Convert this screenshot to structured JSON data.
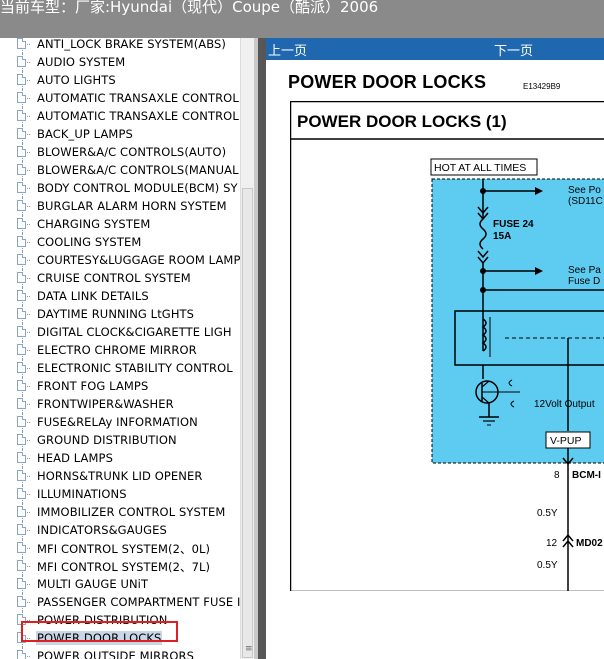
{
  "window": {
    "title": "当前车型：厂家:Hyundai（现代）Coupe（酷派）2006"
  },
  "tree": {
    "items": [
      "ANTI_LOCK BRAKE SYSTEM(ABS)",
      "AUDIO SYSTEM",
      "AUTO LIGHTS",
      "AUTOMATIC TRANSAXLE CONTROL",
      "AUTOMATIC TRANSAXLE CONTROL",
      "BACK_UP LAMPS",
      "BLOWER&A/C CONTROLS(AUTO)",
      "BLOWER&A/C CONTROLS(MANUAL",
      "BODY CONTROL MODULE(BCM) SY",
      "BURGLAR ALARM HORN SYSTEM",
      "CHARGING SYSTEM",
      "COOLING SYSTEM",
      "COURTESY&LUGGAGE ROOM LAMP",
      "CRUISE CONTROL SYSTEM",
      "DATA LINK DETAILS",
      "DAYTIME RUNNING LtGHTS",
      "DIGITAL CLOCK&CIGARETTE LIGH",
      "ELECTRO CHROME MIRROR",
      "ELECTRONIC STABILITY CONTROL",
      "FRONT FOG LAMPS",
      "FRONTWIPER&WASHER",
      "FUSE&RELAy INFORMATION",
      "GROUND DISTRIBUTION",
      "HEAD LAMPS",
      "HORNS&TRUNK LID OPENER",
      "ILLUMINATIONS",
      "IMMOBILIZER CONTROL SYSTEM",
      "INDICATORS&GAUGES",
      "MFI CONTROL SYSTEM(2、0L)",
      "MFI CONTROL SYSTEM(2、7L)",
      "MULTI GAUGE UNiT",
      "PASSENGER COMPARTMENT FUSE I",
      "POWER DISTRIBUTION",
      "POWER DOOR LOCKS",
      "POWER OUTSIDE MIRRORS"
    ],
    "selected_index": 33
  },
  "viewer": {
    "prev_label": "上一页",
    "next_label": "下一页",
    "page_title": "POWER DOOR LOCKS",
    "page_code": "E13429B9",
    "diagram": {
      "title": "POWER DOOR LOCKS (1)",
      "hot_label": "HOT AT ALL TIMES",
      "see_po": "See Po",
      "sd11": "(SD11C",
      "fuse_name": "FUSE 24",
      "fuse_amp": "15A",
      "see_pa": "See Pa",
      "fuse_d": "Fuse D",
      "output_label": "12Volt Output",
      "vpup_label": "V-PUP",
      "pin8": "8",
      "bcm_label": "BCM-I",
      "wire1": "0.5Y",
      "pin12": "12",
      "md_label": "MD02",
      "wire2": "0.5Y"
    },
    "colors": {
      "module_fill": "#5ecbf0",
      "navbar": "#1f68b0"
    }
  }
}
